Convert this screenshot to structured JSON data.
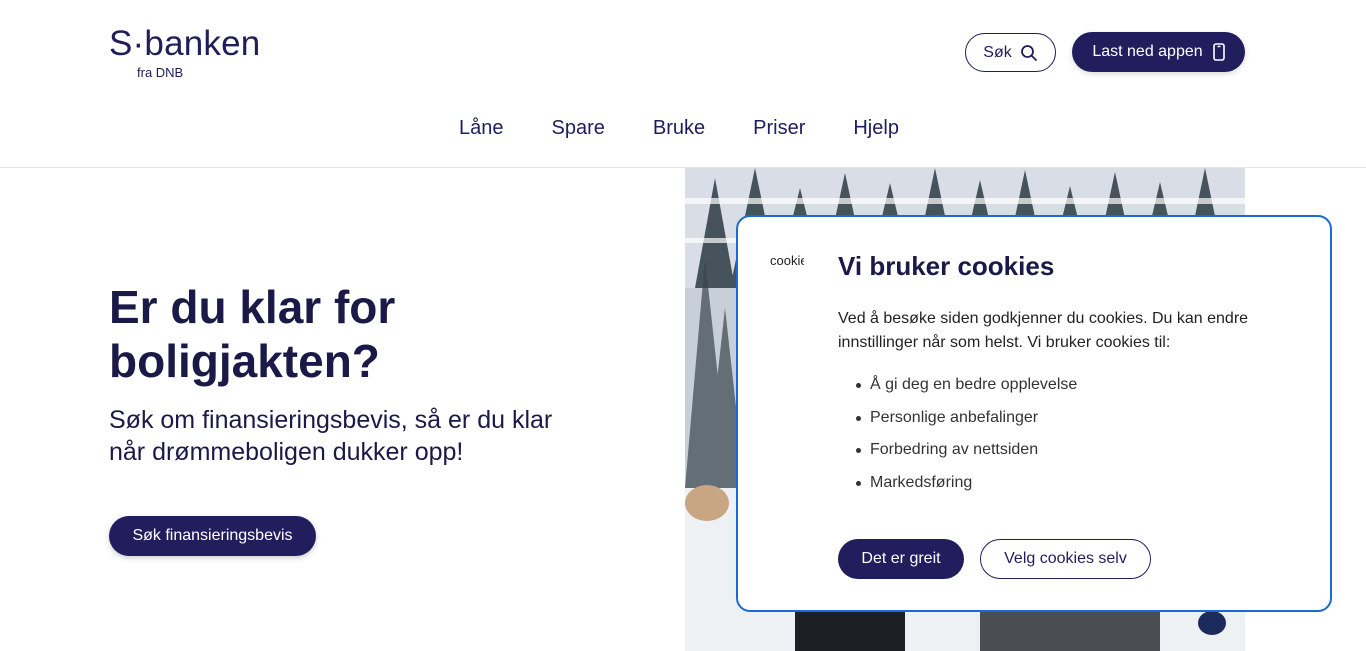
{
  "brand": {
    "logo_text": "S·banken",
    "logo_sub": "fra DNB"
  },
  "header": {
    "search_label": "Søk",
    "app_label": "Last ned appen"
  },
  "nav": {
    "items": [
      {
        "label": "Låne"
      },
      {
        "label": "Spare"
      },
      {
        "label": "Bruke"
      },
      {
        "label": "Priser"
      },
      {
        "label": "Hjelp"
      }
    ]
  },
  "hero": {
    "title": "Er du klar for boligjakten?",
    "subtitle": "Søk om finansieringsbevis, så er du klar når drømmeboligen dukker opp!",
    "cta_label": "Søk finansieringsbevis"
  },
  "cookie_dialog": {
    "image_alt": "cookie",
    "title": "Vi bruker cookies",
    "text": "Ved å besøke siden godkjenner du cookies. Du kan endre innstillinger når som helst. Vi bruker cookies til:",
    "list": [
      "Å gi deg en bedre opplevelse",
      "Personlige anbefalinger",
      "Forbedring av nettsiden",
      "Markedsføring"
    ],
    "accept_label": "Det er greit",
    "choose_label": "Velg cookies selv"
  },
  "colors": {
    "brand_navy": "#221e5e",
    "dialog_border": "#1b6ad4"
  }
}
